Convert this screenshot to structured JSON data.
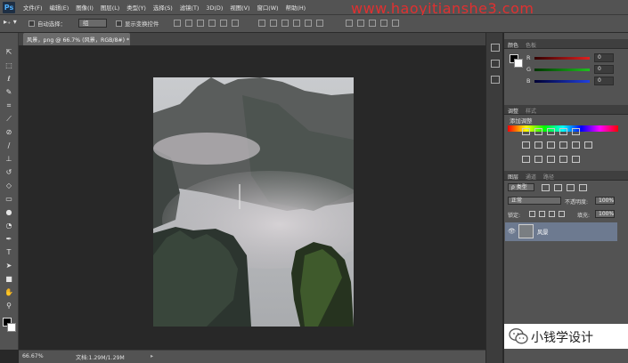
{
  "app": {
    "logo": "Ps"
  },
  "menubar": {
    "items": [
      "文件(F)",
      "编辑(E)",
      "图像(I)",
      "图层(L)",
      "类型(Y)",
      "选择(S)",
      "滤镜(T)",
      "3D(D)",
      "视图(V)",
      "窗口(W)",
      "帮助(H)"
    ],
    "watermark": "www.haoyitianshe3.com"
  },
  "options": {
    "auto_select_label": "自动选择：",
    "auto_select_value": "组",
    "transform_label": "显示变换控件"
  },
  "document": {
    "tab_title": "风景，png @ 66.7% (风景，RGB/8#) *",
    "zoom": "66.67%",
    "doc_info": "文档:1.29M/1.29M"
  },
  "color_panel": {
    "tabs": [
      "颜色",
      "色板"
    ],
    "channels": [
      {
        "label": "R",
        "value": "0",
        "color": "#e02020"
      },
      {
        "label": "G",
        "value": "0",
        "color": "#20c020"
      },
      {
        "label": "B",
        "value": "0",
        "color": "#2040e0"
      }
    ]
  },
  "adjustments_panel": {
    "tabs": [
      "调整",
      "样式"
    ],
    "title": "添加调整"
  },
  "layers_panel": {
    "tabs": [
      "图层",
      "通道",
      "路径"
    ],
    "filter": "ρ 类型",
    "blend_mode": "正常",
    "opacity_label": "不透明度:",
    "opacity_value": "100%",
    "lock_label": "锁定:",
    "fill_label": "填充:",
    "fill_value": "100%",
    "layer_name": "风景"
  },
  "overlay": {
    "wechat_text": "小钱学设计"
  },
  "icons": [
    "move-tool-icon",
    "marquee-tool-icon",
    "lasso-tool-icon",
    "quick-select-tool-icon",
    "crop-tool-icon",
    "eyedropper-tool-icon",
    "healing-brush-icon",
    "brush-tool-icon",
    "clone-stamp-icon",
    "history-brush-icon",
    "eraser-icon",
    "gradient-icon",
    "blur-icon",
    "dodge-icon",
    "pen-tool-icon",
    "type-tool-icon",
    "path-select-icon",
    "rectangle-tool-icon",
    "hand-tool-icon",
    "zoom-tool-icon",
    "eye-icon",
    "wechat-icon"
  ]
}
